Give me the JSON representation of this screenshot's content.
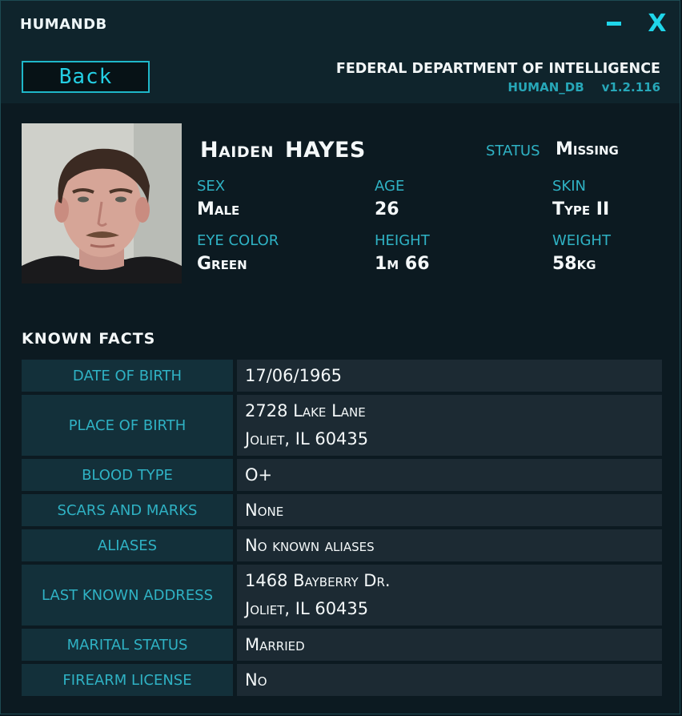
{
  "window": {
    "title": "HUMANDB",
    "minimize_label": "–",
    "close_label": "X"
  },
  "header": {
    "back_label": "Back",
    "agency": "FEDERAL DEPARTMENT OF INTELLIGENCE",
    "db_name": "HUMAN_DB",
    "version": "v1.2.116"
  },
  "profile": {
    "first_name": "Haiden",
    "last_name": "HAYES",
    "status_label": "STATUS",
    "status_value": "Missing",
    "attributes": [
      {
        "label": "SEX",
        "value": "Male"
      },
      {
        "label": "AGE",
        "value": "26"
      },
      {
        "label": "SKIN",
        "value": "Type II"
      },
      {
        "label": "EYE COLOR",
        "value": "Green"
      },
      {
        "label": "HEIGHT",
        "value": "1m 66"
      },
      {
        "label": "WEIGHT",
        "value": "58kg"
      }
    ]
  },
  "facts": {
    "heading": "KNOWN FACTS",
    "rows": [
      {
        "label": "DATE OF BIRTH",
        "lines": [
          "17/06/1965"
        ]
      },
      {
        "label": "PLACE OF BIRTH",
        "lines": [
          "2728 Lake Lane",
          "Joliet, IL 60435"
        ]
      },
      {
        "label": "BLOOD TYPE",
        "lines": [
          "O+"
        ]
      },
      {
        "label": "SCARS AND MARKS",
        "lines": [
          "None"
        ]
      },
      {
        "label": "ALIASES",
        "lines": [
          "No known aliases"
        ]
      },
      {
        "label": "LAST KNOWN ADDRESS",
        "lines": [
          "1468 Bayberry Dr.",
          "Joliet, IL 60435"
        ]
      },
      {
        "label": "MARITAL STATUS",
        "lines": [
          "Married"
        ]
      },
      {
        "label": "FIREARM LICENSE",
        "lines": [
          "No"
        ]
      }
    ]
  },
  "colors": {
    "accent": "#1fd6ea",
    "label": "#2fb2c4",
    "text": "#f4f8f9"
  }
}
